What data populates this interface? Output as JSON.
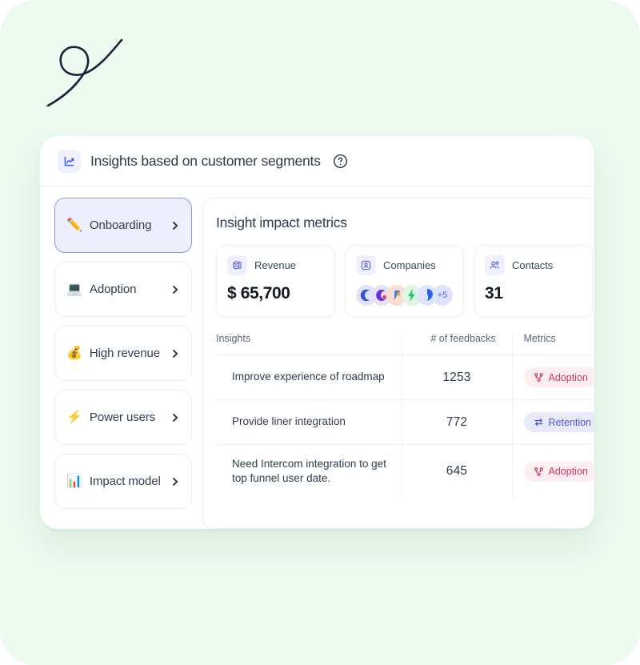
{
  "header": {
    "icon": "line-chart-icon",
    "title": "Insights based on customer segments",
    "help_icon": "help-circle-icon"
  },
  "sidebar": {
    "items": [
      {
        "emoji": "✏️",
        "label": "Onboarding",
        "icon": "pencil-emoji",
        "active": true
      },
      {
        "emoji": "💻",
        "label": "Adoption",
        "icon": "laptop-emoji",
        "active": false
      },
      {
        "emoji": "💰",
        "label": "High revenue",
        "icon": "money-bag-emoji",
        "active": false
      },
      {
        "emoji": "⚡",
        "label": "Power users",
        "icon": "lightning-emoji",
        "active": false
      },
      {
        "emoji": "📊",
        "label": "Impact model",
        "icon": "bar-chart-emoji",
        "active": false
      }
    ],
    "chevron_icon": "chevron-right-icon"
  },
  "panel": {
    "title": "Insight impact metrics",
    "metrics": [
      {
        "name": "Revenue",
        "icon": "coins-icon",
        "value": "$ 65,700",
        "type": "text"
      },
      {
        "name": "Companies",
        "icon": "id-card-icon",
        "value": "+5",
        "type": "avatars"
      },
      {
        "name": "Contacts",
        "icon": "users-icon",
        "value": "31",
        "type": "text"
      }
    ],
    "avatar_overflow_label": "+5",
    "table": {
      "columns": [
        "Insights",
        "# of feedbacks",
        "Metrics"
      ],
      "rows": [
        {
          "insight": "Improve experience of roadmap",
          "feedbacks": "1253",
          "metric": "Adoption",
          "metric_kind": "adoption",
          "metric_icon": "share-nodes-icon"
        },
        {
          "insight": "Provide liner integration",
          "feedbacks": "772",
          "metric": "Retention",
          "metric_kind": "retention",
          "metric_icon": "swap-arrows-icon"
        },
        {
          "insight": "Need Intercom integration to get top funnel user date.",
          "feedbacks": "645",
          "metric": "Adoption",
          "metric_kind": "adoption",
          "metric_icon": "share-nodes-icon"
        }
      ]
    }
  },
  "colors": {
    "page_background": "#ecfaf0",
    "card_background": "#ffffff",
    "accent_indigo": "#5b63d3",
    "active_item_bg": "#eeeffc",
    "active_item_border": "#8f93ef",
    "badge_adoption_bg": "#fdeef1",
    "badge_adoption_text": "#d8365e",
    "badge_retention_bg": "#e8eafc",
    "badge_retention_text": "#4d57d8",
    "text_primary": "#2f3a4c",
    "text_secondary": "#5b6677"
  },
  "decoration": {
    "squiggle": "hand-drawn-loop-flourish"
  }
}
